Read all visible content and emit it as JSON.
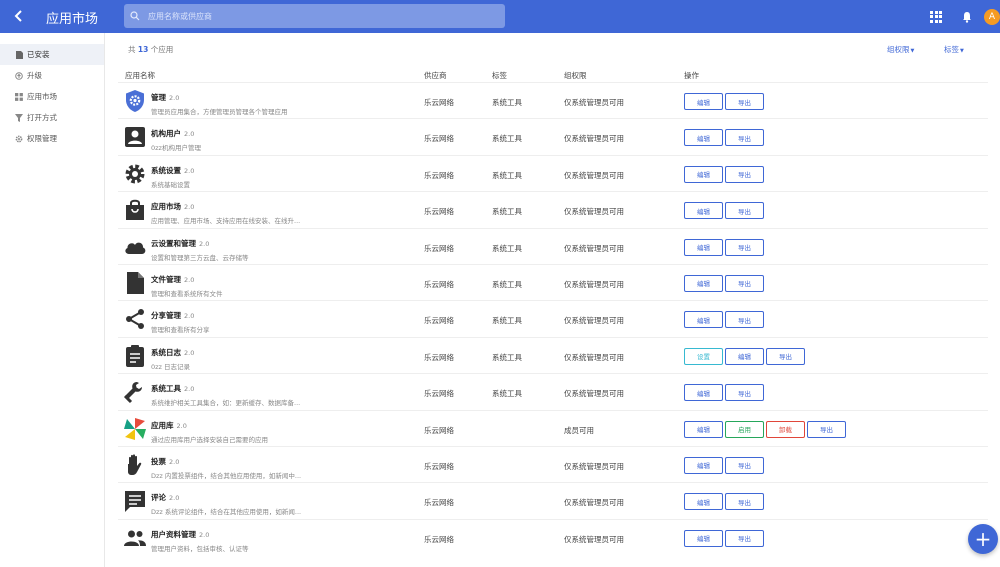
{
  "header": {
    "title": "应用市场",
    "search_placeholder": "应用名称或供应商",
    "avatar_letter": "A",
    "accent": "#3f67d6"
  },
  "sidebar": {
    "items": [
      {
        "label": "已安装",
        "icon": "file-icon"
      },
      {
        "label": "升级",
        "icon": "upgrade-icon"
      },
      {
        "label": "应用市场",
        "icon": "grid-icon"
      },
      {
        "label": "打开方式",
        "icon": "filter-icon"
      },
      {
        "label": "权限管理",
        "icon": "gear-icon"
      }
    ]
  },
  "summary": {
    "prefix": "共",
    "count": "13",
    "suffix": "个应用"
  },
  "filters": {
    "group": "组权限",
    "tag": "标签"
  },
  "columns": {
    "name": "应用名称",
    "vendor": "供应商",
    "tag": "标签",
    "perm": "组权限",
    "ops": "操作"
  },
  "apps": [
    {
      "name": "管理",
      "ver": "2.0",
      "desc": "管理员应用集合，方便管理员管理各个管理应用",
      "vendor": "乐云网络",
      "tag": "系统工具",
      "perm": "仅系统管理员可用",
      "icon": "shield-gear-icon",
      "actions": [
        "编辑",
        "导出"
      ]
    },
    {
      "name": "机构用户",
      "ver": "2.0",
      "desc": "0zz机构用户管理",
      "vendor": "乐云网络",
      "tag": "系统工具",
      "perm": "仅系统管理员可用",
      "icon": "user-card-icon",
      "actions": [
        "编辑",
        "导出"
      ]
    },
    {
      "name": "系统设置",
      "ver": "2.0",
      "desc": "系统基础设置",
      "vendor": "乐云网络",
      "tag": "系统工具",
      "perm": "仅系统管理员可用",
      "icon": "gear-icon",
      "actions": [
        "编辑",
        "导出"
      ]
    },
    {
      "name": "应用市场",
      "ver": "2.0",
      "desc": "应用管理、应用市场、支持应用在线安装、在线升...",
      "vendor": "乐云网络",
      "tag": "系统工具",
      "perm": "仅系统管理员可用",
      "icon": "shopping-bag-icon",
      "actions": [
        "编辑",
        "导出"
      ]
    },
    {
      "name": "云设置和管理",
      "ver": "2.0",
      "desc": "设置和管理第三方云盘、云存储等",
      "vendor": "乐云网络",
      "tag": "系统工具",
      "perm": "仅系统管理员可用",
      "icon": "cloud-icon",
      "actions": [
        "编辑",
        "导出"
      ]
    },
    {
      "name": "文件管理",
      "ver": "2.0",
      "desc": "管理和查看系统所有文件",
      "vendor": "乐云网络",
      "tag": "系统工具",
      "perm": "仅系统管理员可用",
      "icon": "file-icon",
      "actions": [
        "编辑",
        "导出"
      ]
    },
    {
      "name": "分享管理",
      "ver": "2.0",
      "desc": "管理和查看所有分享",
      "vendor": "乐云网络",
      "tag": "系统工具",
      "perm": "仅系统管理员可用",
      "icon": "share-icon",
      "actions": [
        "编辑",
        "导出"
      ]
    },
    {
      "name": "系统日志",
      "ver": "2.0",
      "desc": "0zz 日志记录",
      "vendor": "乐云网络",
      "tag": "系统工具",
      "perm": "仅系统管理员可用",
      "icon": "clipboard-icon",
      "actions": [
        "设置",
        "编辑",
        "导出"
      ]
    },
    {
      "name": "系统工具",
      "ver": "2.0",
      "desc": "系统维护相关工具集合，如：更新缓存、数据库备...",
      "vendor": "乐云网络",
      "tag": "系统工具",
      "perm": "仅系统管理员可用",
      "icon": "wrench-icon",
      "actions": [
        "编辑",
        "导出"
      ]
    },
    {
      "name": "应用库",
      "ver": "2.0",
      "desc": "通过应用库用户选择安装自己需要的应用",
      "vendor": "乐云网络",
      "tag": "",
      "perm": "成员可用",
      "icon": "pinwheel-icon",
      "actions": [
        "编辑",
        "启用",
        "卸载",
        "导出"
      ]
    },
    {
      "name": "投票",
      "ver": "2.0",
      "desc": "Dzz 内置投票组件，结合其他应用使用，如新闻中...",
      "vendor": "乐云网络",
      "tag": "",
      "perm": "仅系统管理员可用",
      "icon": "hand-icon",
      "actions": [
        "编辑",
        "导出"
      ]
    },
    {
      "name": "评论",
      "ver": "2.0",
      "desc": "Dzz 系统评论组件，结合在其他应用使用，如新闻...",
      "vendor": "乐云网络",
      "tag": "",
      "perm": "仅系统管理员可用",
      "icon": "comment-icon",
      "actions": [
        "编辑",
        "导出"
      ]
    },
    {
      "name": "用户资料管理",
      "ver": "2.0",
      "desc": "管理用户资料，包括审核、认证等",
      "vendor": "乐云网络",
      "tag": "",
      "perm": "仅系统管理员可用",
      "icon": "users-icon",
      "actions": [
        "编辑",
        "导出"
      ]
    }
  ]
}
